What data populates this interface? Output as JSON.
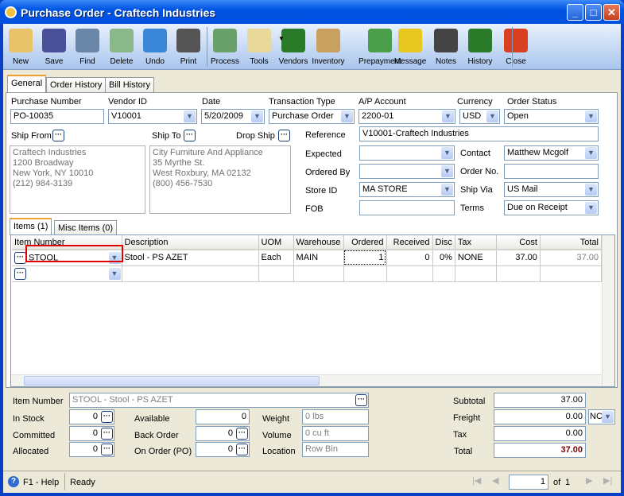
{
  "window": {
    "title": "Purchase Order - Craftech Industries",
    "controls": [
      "_",
      "□",
      "✕"
    ]
  },
  "toolbar": [
    {
      "label": "New",
      "icon": "new-icon"
    },
    {
      "label": "Save",
      "icon": "save-icon"
    },
    {
      "label": "Find",
      "icon": "find-icon"
    },
    {
      "label": "Delete",
      "icon": "delete-icon"
    },
    {
      "label": "Undo",
      "icon": "undo-icon"
    },
    {
      "label": "Print",
      "icon": "print-icon"
    },
    {
      "label": "Process",
      "icon": "process-icon"
    },
    {
      "label": "Tools",
      "icon": "tools-icon"
    },
    {
      "label": "Vendors",
      "icon": "vendors-icon"
    },
    {
      "label": "Inventory",
      "icon": "inventory-icon"
    },
    {
      "label": "Prepayment",
      "icon": "prepayment-icon"
    },
    {
      "label": "Message",
      "icon": "message-icon"
    },
    {
      "label": "Notes",
      "icon": "notes-icon"
    },
    {
      "label": "History",
      "icon": "history-icon"
    },
    {
      "label": "Close",
      "icon": "close-icon"
    }
  ],
  "tabs": [
    "General",
    "Order History",
    "Bill History"
  ],
  "header": {
    "purchase_number": {
      "label": "Purchase Number",
      "value": "PO-10035"
    },
    "vendor_id": {
      "label": "Vendor ID",
      "value": "V10001"
    },
    "date": {
      "label": "Date",
      "value": "5/20/2009"
    },
    "transaction_type": {
      "label": "Transaction Type",
      "value": "Purchase Order"
    },
    "ap_account": {
      "label": "A/P Account",
      "value": "2200-01"
    },
    "currency": {
      "label": "Currency",
      "value": "USD"
    },
    "order_status": {
      "label": "Order Status",
      "value": "Open"
    }
  },
  "ship_from": {
    "label": "Ship From",
    "address": "Craftech Industries\n1200 Broadway\nNew York, NY 10010\n(212) 984-3139"
  },
  "ship_to": {
    "label": "Ship To",
    "address": "City Furniture And Appliance\n35 Myrthe St.\nWest Roxbury, MA 02132\n(800) 456-7530"
  },
  "drop_ship": {
    "label": "Drop Ship"
  },
  "details": {
    "reference": {
      "label": "Reference",
      "value": "V10001-Craftech Industries"
    },
    "expected": {
      "label": "Expected",
      "value": ""
    },
    "contact": {
      "label": "Contact",
      "value": "Matthew Mcgolf"
    },
    "ordered_by": {
      "label": "Ordered By",
      "value": ""
    },
    "order_no": {
      "label": "Order No.",
      "value": ""
    },
    "store_id": {
      "label": "Store ID",
      "value": "MA STORE"
    },
    "ship_via": {
      "label": "Ship Via",
      "value": "US Mail"
    },
    "fob": {
      "label": "FOB",
      "value": ""
    },
    "terms": {
      "label": "Terms",
      "value": "Due on Receipt"
    }
  },
  "item_tabs": [
    "Items (1)",
    "Misc Items (0)"
  ],
  "grid": {
    "columns": [
      "Item Number",
      "Description",
      "UOM",
      "Warehouse",
      "Ordered",
      "Received",
      "Disc",
      "Tax",
      "Cost",
      "Total"
    ],
    "rows": [
      [
        "STOOL",
        "Stool - PS AZET",
        "Each",
        "MAIN",
        "1",
        "0",
        "0%",
        "NONE",
        "37.00",
        "37.00"
      ]
    ]
  },
  "item_info": {
    "item_number": {
      "label": "Item Number",
      "value": "STOOL - Stool - PS AZET"
    },
    "in_stock": {
      "label": "In Stock",
      "value": "0"
    },
    "committed": {
      "label": "Committed",
      "value": "0"
    },
    "allocated": {
      "label": "Allocated",
      "value": "0"
    },
    "available": {
      "label": "Available",
      "value": "0"
    },
    "back_order": {
      "label": "Back Order",
      "value": "0"
    },
    "on_order": {
      "label": "On Order (PO)",
      "value": "0"
    },
    "weight": {
      "label": "Weight",
      "value": "0 lbs"
    },
    "volume": {
      "label": "Volume",
      "value": "0 cu ft"
    },
    "location": {
      "label": "Location",
      "value": "Row  Bin"
    }
  },
  "totals": {
    "subtotal": {
      "label": "Subtotal",
      "value": "37.00"
    },
    "freight": {
      "label": "Freight",
      "value": "0.00",
      "code": "NC"
    },
    "tax": {
      "label": "Tax",
      "value": "0.00"
    },
    "total": {
      "label": "Total",
      "value": "37.00",
      "color": "#800000"
    }
  },
  "status": {
    "help": "F1 - Help",
    "text": "Ready",
    "page": "1",
    "of_label": "of",
    "page_count": "1"
  }
}
